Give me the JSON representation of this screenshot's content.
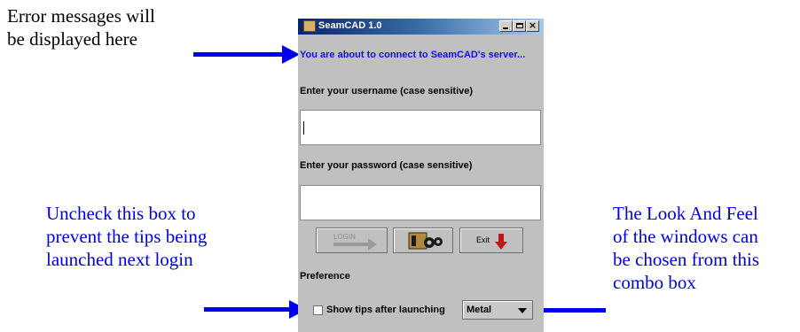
{
  "callouts": {
    "error_line1": "Error messages will",
    "error_line2": "be displayed here",
    "tips_line1": "Uncheck this box to",
    "tips_line2": "prevent the tips being",
    "tips_line3": "launched next login",
    "laf_line1": "The Look And Feel",
    "laf_line2": "of the windows can",
    "laf_line3": "be chosen from this",
    "laf_line4": "combo box"
  },
  "window": {
    "title": "SeamCAD 1.0",
    "icon": "seamcad-app-icon"
  },
  "login": {
    "status_message": "You are about to connect to SeamCAD's server...",
    "username_label": "Enter your username (case sensitive)",
    "username_value": "",
    "password_label": "Enter your password (case sensitive)",
    "password_value": "",
    "login_button": "LOGIN",
    "exit_button": "Exit"
  },
  "preference": {
    "label": "Preference",
    "show_tips_label": "Show tips after launching",
    "show_tips_checked": false,
    "look_and_feel": "Metal"
  },
  "colors": {
    "callout_blue": "#0000e8",
    "arrow_blue": "#0000ee",
    "status_blue": "#1010e0",
    "window_gray": "#c0c0c0",
    "title_start": "#0a246a",
    "title_end": "#a6caf0"
  }
}
